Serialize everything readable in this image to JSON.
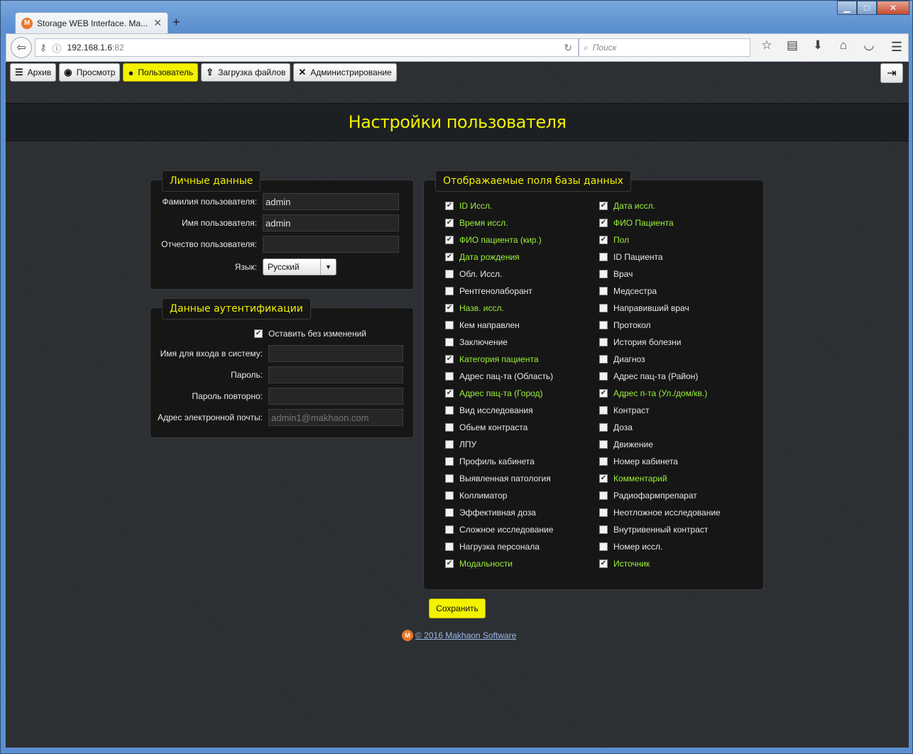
{
  "browser": {
    "tab_title": "Storage WEB Interface. Ma...",
    "tab_close": "✕",
    "new_tab": "+",
    "url_host": "192.168.1.6",
    "url_port": ":82",
    "search_placeholder": "Поиск"
  },
  "topmenu": {
    "items": [
      {
        "label": "Архив",
        "icon": "list-icon"
      },
      {
        "label": "Просмотр",
        "icon": "eye-icon"
      },
      {
        "label": "Пользователь",
        "icon": "user-icon",
        "active": true
      },
      {
        "label": "Загрузка файлов",
        "icon": "upload-icon"
      },
      {
        "label": "Администрирование",
        "icon": "tools-icon"
      }
    ]
  },
  "page": {
    "title": "Настройки пользователя"
  },
  "personal": {
    "legend": "Личные данные",
    "surname_label": "Фамилия пользователя:",
    "surname_value": "admin",
    "name_label": "Имя пользователя:",
    "name_value": "admin",
    "patronymic_label": "Отчество пользователя:",
    "patronymic_value": "",
    "language_label": "Язык:",
    "language_value": "Русский"
  },
  "auth": {
    "legend": "Данные аутентификации",
    "keep_label": "Оставить без изменений",
    "keep_checked": true,
    "login_label": "Имя для входа в систему:",
    "password_label": "Пароль:",
    "password_repeat_label": "Пароль повторно:",
    "email_label": "Адрес электронной почты:",
    "email_placeholder": "admin1@makhaon.com"
  },
  "fields": {
    "legend": "Отображаемые поля базы данных",
    "left": [
      {
        "label": "ID Иссл.",
        "checked": true
      },
      {
        "label": "Время иссл.",
        "checked": true
      },
      {
        "label": "ФИО пациента (кир.)",
        "checked": true
      },
      {
        "label": "Дата рождения",
        "checked": true
      },
      {
        "label": "Обл. Иссл.",
        "checked": false
      },
      {
        "label": "Рентгенолаборант",
        "checked": false
      },
      {
        "label": "Назв. иссл.",
        "checked": true
      },
      {
        "label": "Кем направлен",
        "checked": false
      },
      {
        "label": "Заключение",
        "checked": false
      },
      {
        "label": "Категория пациента",
        "checked": true
      },
      {
        "label": "Адрес пац-та (Область)",
        "checked": false
      },
      {
        "label": "Адрес пац-та (Город)",
        "checked": true
      },
      {
        "label": "Вид исследования",
        "checked": false
      },
      {
        "label": "Обьем контраста",
        "checked": false
      },
      {
        "label": "ЛПУ",
        "checked": false
      },
      {
        "label": "Профиль кабинета",
        "checked": false
      },
      {
        "label": "Выявленная патология",
        "checked": false
      },
      {
        "label": "Коллиматор",
        "checked": false
      },
      {
        "label": "Эффективная доза",
        "checked": false
      },
      {
        "label": "Сложное исследование",
        "checked": false
      },
      {
        "label": "Нагрузка персонала",
        "checked": false
      },
      {
        "label": "Модальности",
        "checked": true
      }
    ],
    "right": [
      {
        "label": "Дата иссл.",
        "checked": true
      },
      {
        "label": "ФИО Пациента",
        "checked": true
      },
      {
        "label": "Пол",
        "checked": true
      },
      {
        "label": "ID Пациента",
        "checked": false
      },
      {
        "label": "Врач",
        "checked": false
      },
      {
        "label": "Медсестра",
        "checked": false
      },
      {
        "label": "Направивший врач",
        "checked": false
      },
      {
        "label": "Протокол",
        "checked": false
      },
      {
        "label": "История болезни",
        "checked": false
      },
      {
        "label": "Диагноз",
        "checked": false
      },
      {
        "label": "Адрес пац-та (Район)",
        "checked": false
      },
      {
        "label": "Адрес п-та (Ул./дом/кв.)",
        "checked": true
      },
      {
        "label": "Контраст",
        "checked": false
      },
      {
        "label": "Доза",
        "checked": false
      },
      {
        "label": "Движение",
        "checked": false
      },
      {
        "label": "Номер кабинета",
        "checked": false
      },
      {
        "label": "Комментарий",
        "checked": true
      },
      {
        "label": "Радиофармпрепарат",
        "checked": false
      },
      {
        "label": "Неотложное исследование",
        "checked": false
      },
      {
        "label": "Внутривенный контраст",
        "checked": false
      },
      {
        "label": "Номер иссл.",
        "checked": false
      },
      {
        "label": "Источник",
        "checked": true
      }
    ]
  },
  "actions": {
    "save_label": "Сохранить"
  },
  "footer": {
    "text": "© 2016 Makhaon Software"
  }
}
